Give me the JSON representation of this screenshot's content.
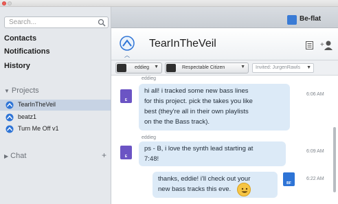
{
  "sidebar": {
    "search_placeholder": "Search...",
    "nav": [
      "Contacts",
      "Notifications",
      "History"
    ],
    "projects_header": "Projects",
    "projects": [
      "TearInTheVeil",
      "beatz1",
      "Turn Me Off v1"
    ],
    "chat_header": "Chat",
    "chat_add": "+"
  },
  "header": {
    "user": "Be-flat",
    "project_title": "TearInTheVeil"
  },
  "filters": {
    "user_filter": "eddieg",
    "role_filter": "Respectable Citizen",
    "invited": "Invited: JurgenRawls"
  },
  "messages": [
    {
      "sender": "eddieg",
      "lines": [
        "hi all! i tracked some new bass lines",
        "for this project. pick the takes you like",
        "best (they're all in their own playlists",
        "on the the Bass track)."
      ],
      "time": "6:06 AM",
      "avatar_label": "E"
    },
    {
      "sender": "eddieg",
      "lines": [
        "ps - B, i love the synth lead starting at",
        "7:48!"
      ],
      "time": "6:09 AM",
      "avatar_label": "E"
    },
    {
      "sender": "",
      "lines": [
        "thanks, eddie! i'll check out your",
        "new bass tracks this eve."
      ],
      "time": "6:22 AM",
      "avatar_label": "BF"
    }
  ],
  "colors": {
    "accent": "#2e74d6",
    "bubble": "#dceaf7",
    "selected_row": "#c7d3e4",
    "avatar_purple": "#6b54c4"
  }
}
